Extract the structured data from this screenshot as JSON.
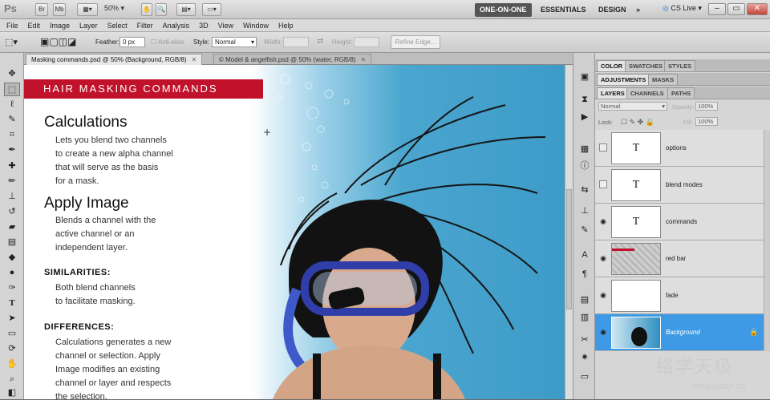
{
  "app": {
    "logo": "Ps",
    "bridge_label": "Br",
    "minibridge_label": "Mb",
    "zoom": "50%"
  },
  "workspaces": {
    "active": "ONE-ON-ONE",
    "essentials": "ESSENTIALS",
    "design": "DESIGN",
    "more": "»",
    "cslive": "CS Live"
  },
  "menu": [
    "File",
    "Edit",
    "Image",
    "Layer",
    "Select",
    "Filter",
    "Analysis",
    "3D",
    "View",
    "Window",
    "Help"
  ],
  "options": {
    "feather_label": "Feather:",
    "feather_value": "0 px",
    "antialias_label": "Anti-alias",
    "style_label": "Style:",
    "style_value": "Normal",
    "width_label": "Width:",
    "height_label": "Height:",
    "refine_label": "Refine Edge..."
  },
  "tabs": [
    {
      "label": "Masking commands.psd @ 50% (Background, RGB/8)",
      "active": true
    },
    {
      "label": "© Model & angelfish.psd @ 50% (water, RGB/8)",
      "active": false
    }
  ],
  "canvas": {
    "banner": "HAIR MASKING COMMANDS",
    "calc_title": "Calculations",
    "calc_lines": [
      "Lets you blend two channels",
      "to create a new alpha channel",
      "that will serve as the basis",
      "for a mask."
    ],
    "apply_title": "Apply Image",
    "apply_lines": [
      "Blends a channel with the",
      "active channel or an",
      "independent layer."
    ],
    "sim_title": "SIMILARITIES:",
    "sim_lines": [
      "Both blend channels",
      "to facilitate masking."
    ],
    "diff_title": "DIFFERENCES:",
    "diff_lines": [
      "Calculations generates a new",
      "channel or selection. Apply",
      "Image modifies an existing",
      "channel or layer and respects",
      "the selection."
    ]
  },
  "panels": {
    "row1": [
      "COLOR",
      "SWATCHES",
      "STYLES"
    ],
    "row2": [
      "ADJUSTMENTS",
      "MASKS"
    ],
    "row3": [
      "LAYERS",
      "CHANNELS",
      "PATHS"
    ],
    "blend_mode": "Normal",
    "opacity_label": "Opacity:",
    "opacity_value": "100%",
    "lock_label": "Lock:",
    "fill_label": "Fill:",
    "fill_value": "100%"
  },
  "layers": [
    {
      "name": "options",
      "thumb": "T",
      "visible": false
    },
    {
      "name": "blend modes",
      "thumb": "T",
      "visible": false
    },
    {
      "name": "commands",
      "thumb": "T",
      "visible": true
    },
    {
      "name": "red bar",
      "thumb": "",
      "visible": true
    },
    {
      "name": "fade",
      "thumb": "",
      "visible": true
    },
    {
      "name": "Background",
      "thumb": "",
      "visible": true,
      "selected": true
    }
  ],
  "watermark": {
    "chars": "络学天极",
    "url": "www.luoan.cn"
  },
  "colors": {
    "banner": "#c0122b",
    "selected_layer": "#3f9ae5",
    "water": "#3e9bc8"
  }
}
